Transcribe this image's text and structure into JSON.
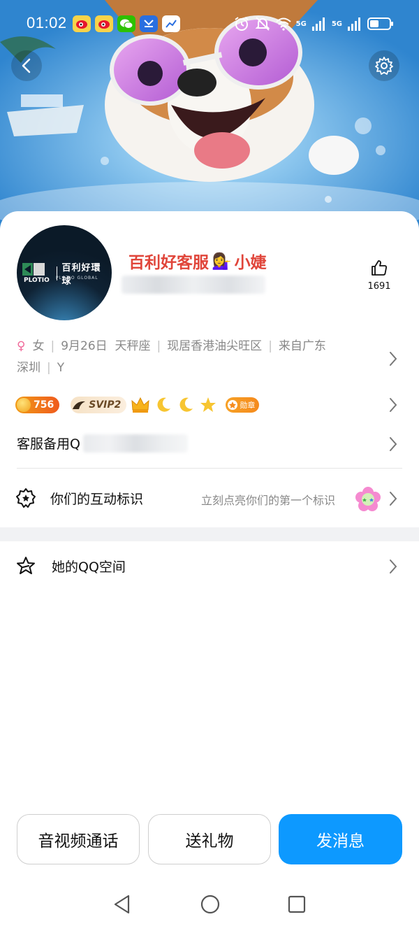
{
  "status_bar": {
    "time": "01:02",
    "network_1": "5G",
    "network_2": "5G",
    "apps": [
      "weibo-icon",
      "weibo-icon",
      "wechat-icon",
      "tmall-icon",
      "chart-app-icon"
    ],
    "system_icons": [
      "alarm-icon",
      "mute-icon",
      "wifi-icon",
      "signal-icon",
      "signal-icon",
      "battery-icon"
    ]
  },
  "header": {
    "back_icon": "chevron-left-icon",
    "settings_icon": "gear-icon"
  },
  "profile": {
    "avatar_brand": "PLOTIO",
    "avatar_name_cn": "百利好環球",
    "avatar_name_en": "PLOTIO GLOBAL",
    "nickname_prefix": "百利好客服",
    "nickname_emoji": "💁‍♀️",
    "nickname_suffix": "小婕",
    "likes_count": "1691",
    "likes_icon": "thumbs-up-icon"
  },
  "info": {
    "gender_symbol": "♀",
    "gender": "女",
    "birthday": "9月26日",
    "zodiac": "天秤座",
    "location": "现居香港油尖旺区",
    "hometown_prefix": "来自广东",
    "hometown_city": "深圳",
    "extra": "Y"
  },
  "badges": {
    "level": "756",
    "svip": "SVIP2",
    "medal": "勋章",
    "icons": [
      "crown-icon",
      "moon-icon",
      "moon-icon",
      "star-icon"
    ]
  },
  "backup": {
    "label": "客服备用Q"
  },
  "interact": {
    "label": "你们的互动标识",
    "hint": "立刻点亮你们的第一个标识"
  },
  "qzone": {
    "label": "她的QQ空间"
  },
  "actions": {
    "call": "音视频通话",
    "gift": "送礼物",
    "message": "发消息"
  },
  "colors": {
    "nickname": "#e0453a",
    "primary": "#0d99ff",
    "secondary_text": "#888888",
    "gender": "#f06a9a"
  }
}
